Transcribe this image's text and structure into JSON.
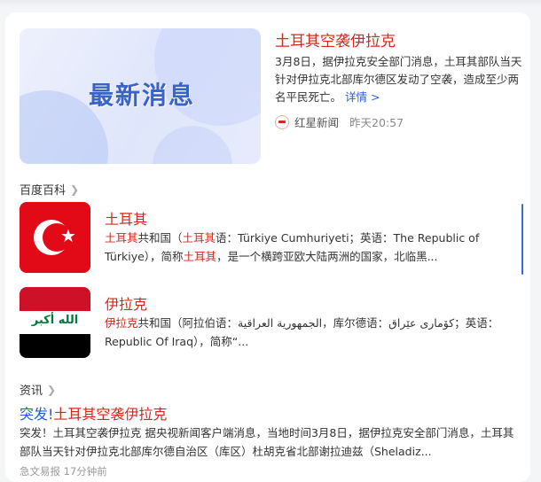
{
  "news": {
    "image_caption": "最新消息",
    "title": "土耳其空袭伊拉克",
    "summary": "3月8日，据伊拉克安全部门消息，土耳其部队当天针对伊拉克北部库尔德区发动了空袭，造成至少两名平民死亡。",
    "more_label": "详情 >",
    "source": "红星新闻",
    "time": "昨天20:57"
  },
  "baike": {
    "section_label": "百度百科",
    "entries": [
      {
        "title": "土耳其",
        "desc_hl1": "土耳其",
        "desc_t1": "共和国（",
        "desc_hl2": "土耳其",
        "desc_t2": "语：Türkiye Cumhuriyeti；英语：The Republic of Türkiye），简称",
        "desc_hl3": "土耳其",
        "desc_t3": "，是一个横跨亚欧大陆两洲的国家，北临黑..."
      },
      {
        "title": "伊拉克",
        "desc_hl1": "伊拉克",
        "desc_t1": "共和国（阿拉伯语：الجمهورية العراقية，库尔德语：کۆماری عێراق；英语：Republic Of Iraq），简称“...",
        "flag_script": "الله أكبر"
      }
    ]
  },
  "info": {
    "section_label": "资讯",
    "title_prefix": "突发!",
    "title_rest": "土耳其空袭伊拉克",
    "desc": "突发！土耳其空袭伊拉克 据央视新闻客户端消息，当地时间3月8日，据伊拉克安全部门消息，土耳其部队当天针对伊拉克北部库尔德自治区（库区）杜胡克省北部谢拉迪兹（Sheladiz...",
    "meta": "急文易报 17分钟前"
  },
  "colors": {
    "accent_red": "#d1281f",
    "link_blue": "#2a5bd7"
  }
}
